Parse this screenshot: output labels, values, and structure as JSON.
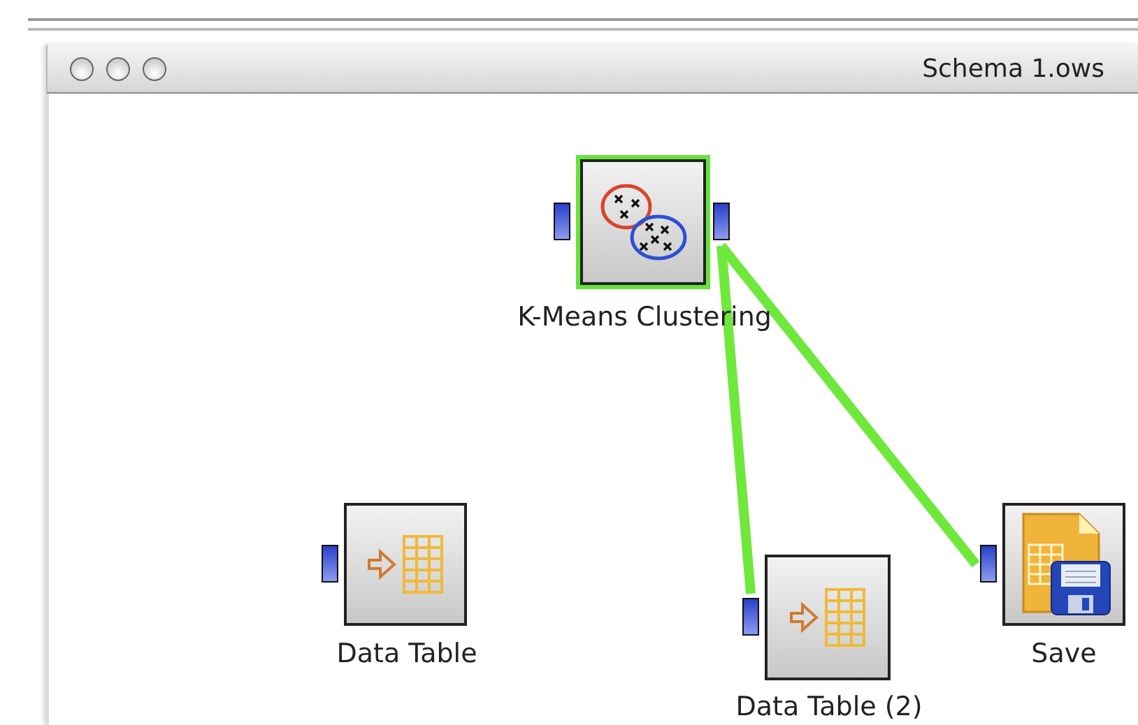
{
  "window": {
    "title": "Schema 1.ows"
  },
  "nodes": [
    {
      "label": "K-Means Clustering",
      "kind": "kmeans",
      "selected": true,
      "linked": false
    },
    {
      "label": "Data Table",
      "kind": "table",
      "selected": false,
      "linked": false
    },
    {
      "label": "Data Table (2)",
      "kind": "table",
      "selected": false,
      "linked": true
    },
    {
      "label": "Save",
      "kind": "save",
      "selected": false,
      "linked": true
    }
  ]
}
